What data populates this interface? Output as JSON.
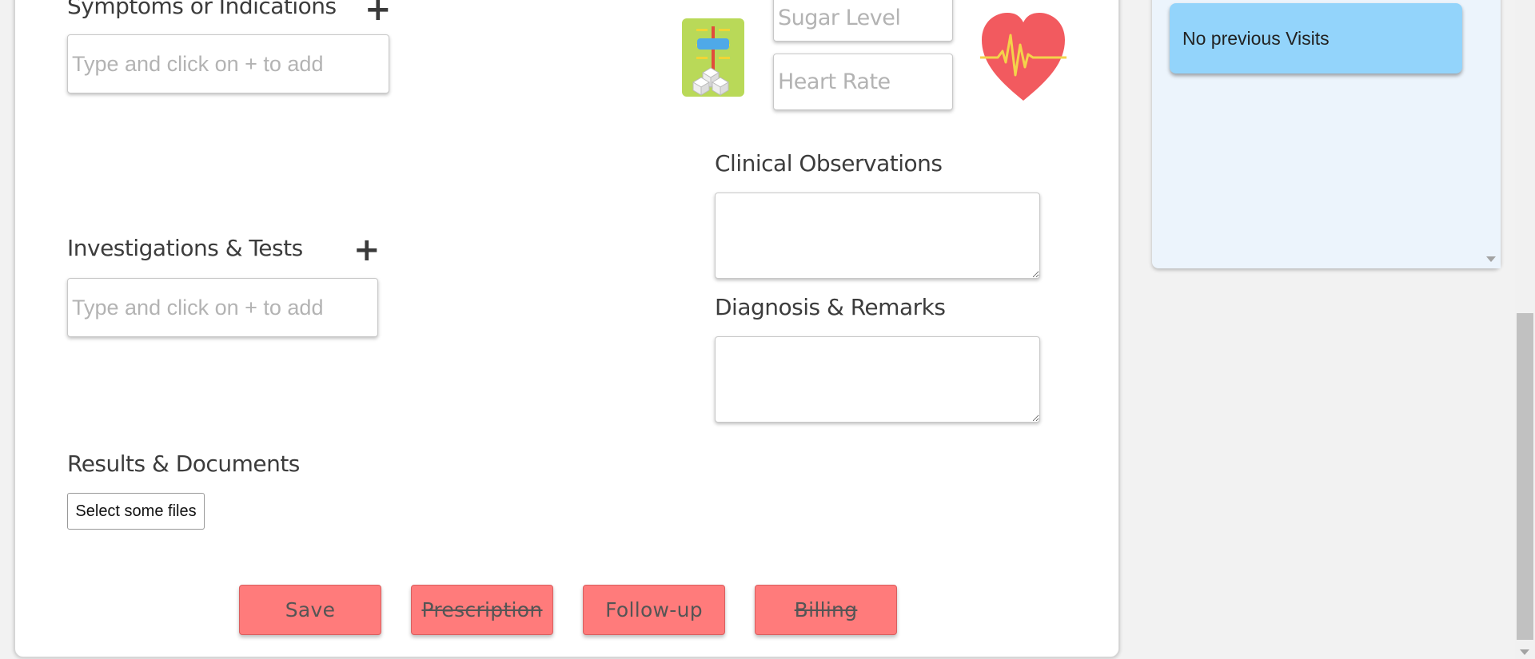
{
  "symptoms": {
    "label": "Symptoms or Indications",
    "placeholder": "Type and click on + to add",
    "add_symbol": "+"
  },
  "vitals": {
    "sugar_placeholder": "Sugar Level",
    "heart_rate_placeholder": "Heart Rate",
    "sugar_icon": "sugar-level-icon",
    "heart_icon": "heart-rate-icon"
  },
  "investigations": {
    "label": "Investigations & Tests",
    "placeholder": "Type and click on + to add",
    "add_symbol": "+"
  },
  "clinical_observations": {
    "label": "Clinical Observations"
  },
  "diagnosis": {
    "label": "Diagnosis & Remarks"
  },
  "results": {
    "label": "Results & Documents",
    "file_button": "Select some files"
  },
  "actions": {
    "save": "Save",
    "prescription": "Prescription",
    "followup": "Follow-up",
    "billing": "Billing"
  },
  "visits": {
    "empty_text": "No previous Visits"
  },
  "colors": {
    "action_button": "#ff7b7b",
    "visit_card": "#93d4fb",
    "visits_panel": "#ecf4fc",
    "heart": "#f25a5f",
    "sugar_icon_bg": "#b9d958"
  }
}
